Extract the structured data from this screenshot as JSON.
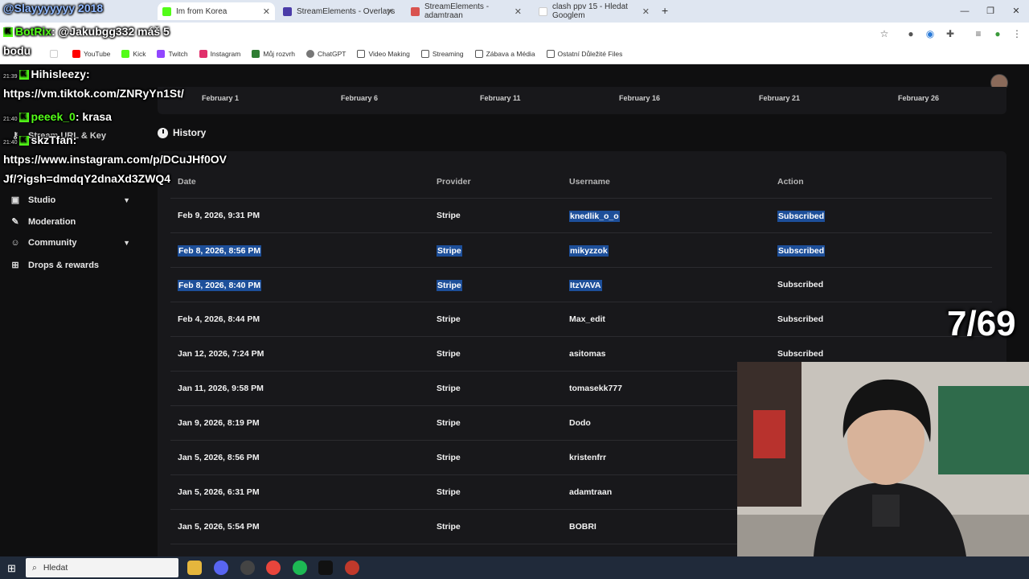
{
  "browser": {
    "tabs": [
      {
        "title": "Im from Korea",
        "active": true
      },
      {
        "title": "StreamElements - Overlays"
      },
      {
        "title": "StreamElements - adamtraan"
      },
      {
        "title": "clash ppv 15 - Hledat Googlem"
      }
    ],
    "new_tab": "+",
    "bookmarks": [
      "YouTube",
      "Kick",
      "Twitch",
      "Instagram",
      "Můj rozvrh",
      "ChatGPT",
      "Video Making",
      "Streaming",
      "Zábava a Média",
      "Ostatní Důležité Files"
    ]
  },
  "sidebar": {
    "items": [
      {
        "label": "Stream URL & Key",
        "icon": "key-icon"
      },
      {
        "label": "Studio",
        "icon": "studio-icon",
        "expandable": true
      },
      {
        "label": "Moderation",
        "icon": "wrench-icon"
      },
      {
        "label": "Community",
        "icon": "community-icon",
        "expandable": true
      },
      {
        "label": "Drops & rewards",
        "icon": "gift-icon"
      }
    ]
  },
  "chart": {
    "x_ticks": [
      "February 1",
      "February 6",
      "February 11",
      "February 16",
      "February 21",
      "February 26"
    ]
  },
  "history": {
    "title": "History",
    "columns": [
      "Date",
      "Provider",
      "Username",
      "Action"
    ],
    "rows": [
      {
        "date": "Feb 9, 2026, 9:31 PM",
        "provider": "Stripe",
        "username": "knedlik_o_o",
        "action": "Subscribed"
      },
      {
        "date": "Feb 8, 2026, 8:56 PM",
        "provider": "Stripe",
        "username": "mikyzzok",
        "action": "Subscribed"
      },
      {
        "date": "Feb 8, 2026, 8:40 PM",
        "provider": "Stripe",
        "username": "ItzVAVA",
        "action": "Subscribed"
      },
      {
        "date": "Feb 4, 2026, 8:44 PM",
        "provider": "Stripe",
        "username": "Max_edit",
        "action": "Subscribed"
      },
      {
        "date": "Jan 12, 2026, 7:24 PM",
        "provider": "Stripe",
        "username": "asitomas",
        "action": "Subscribed"
      },
      {
        "date": "Jan 11, 2026, 9:58 PM",
        "provider": "Stripe",
        "username": "tomasekk777",
        "action": ""
      },
      {
        "date": "Jan 9, 2026, 8:19 PM",
        "provider": "Stripe",
        "username": "Dodo",
        "action": ""
      },
      {
        "date": "Jan 5, 2026, 8:56 PM",
        "provider": "Stripe",
        "username": "kristenfrr",
        "action": ""
      },
      {
        "date": "Jan 5, 2026, 6:31 PM",
        "provider": "Stripe",
        "username": "adamtraan",
        "action": ""
      },
      {
        "date": "Jan 5, 2026, 5:54 PM",
        "provider": "Stripe",
        "username": "BOBRI",
        "action": ""
      }
    ]
  },
  "overlay": {
    "chat": [
      {
        "time": "",
        "user": "@Slayyyyyyy 2018",
        "text": ""
      },
      {
        "time": "",
        "user": "BotRix",
        "text": ": @Jakubgg332 máš 5"
      },
      {
        "time": "",
        "user": "",
        "text": "bodu"
      },
      {
        "time": "21:39",
        "user": "Hihisleezy",
        "text": ":"
      },
      {
        "time": "",
        "user": "",
        "text": "https://vm.tiktok.com/ZNRyYn1St/"
      },
      {
        "time": "21:40",
        "user": "peeek_0",
        "text": ": krasa"
      },
      {
        "time": "21:40",
        "user": "skzTfan",
        "text": ":"
      },
      {
        "time": "",
        "user": "",
        "text": "https://www.instagram.com/p/DCuJHf0OV"
      },
      {
        "time": "",
        "user": "",
        "text": "Jf/?igsh=dmdqY2dnaXd3ZWQ4"
      }
    ],
    "counter": "7/69"
  },
  "taskbar": {
    "search_placeholder": "Hledat"
  }
}
